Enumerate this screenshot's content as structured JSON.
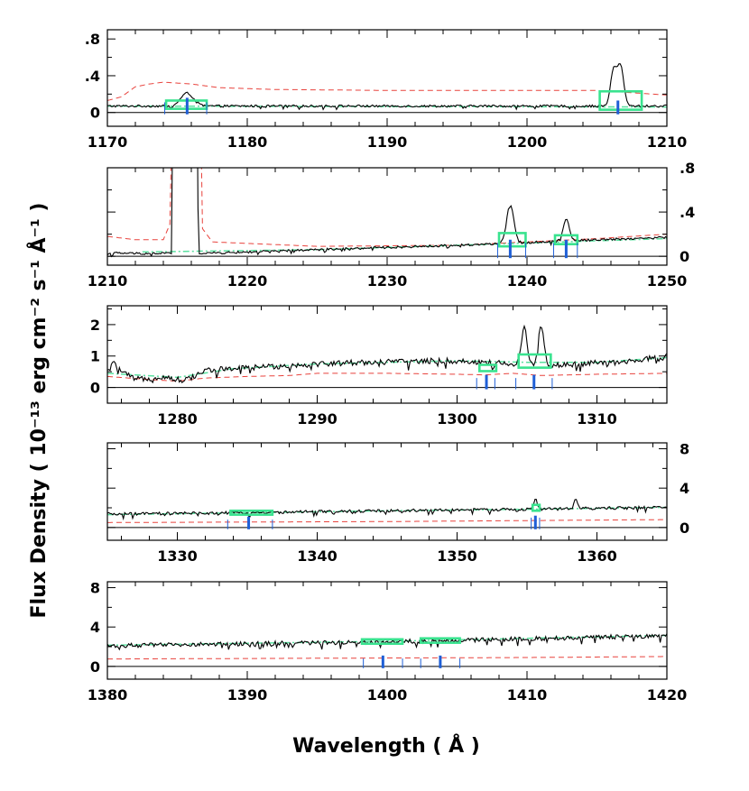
{
  "figure": {
    "ylabel": "Flux Density  ( 10⁻¹³ erg cm⁻² s⁻¹ Å⁻¹ )",
    "xlabel": "Wavelength  ( Å )",
    "colors": {
      "spectrum": "#000000",
      "error": "#e8423c",
      "continuum": "#5be0a0",
      "box": "#39e38f",
      "marker": "#1f5fd6",
      "axis": "#000000"
    }
  },
  "chart_data": [
    {
      "type": "line",
      "xlim": [
        1170,
        1210
      ],
      "ylim": [
        -0.15,
        0.9
      ],
      "xticks": [
        1170,
        1180,
        1190,
        1200,
        1210
      ],
      "xtick_labels": [
        "1170",
        "1180",
        "1190",
        "1200",
        "1210"
      ],
      "yticks": [
        0,
        0.4,
        0.8
      ],
      "ytick_labels": [
        "0",
        ".4",
        ".8"
      ],
      "yaxis_side": "left",
      "flux_baseline": 0.07,
      "flux_noise": 0.012,
      "error_points": [
        [
          1170,
          0.13
        ],
        [
          1171,
          0.17
        ],
        [
          1172,
          0.28
        ],
        [
          1173,
          0.31
        ],
        [
          1174,
          0.33
        ],
        [
          1176,
          0.31
        ],
        [
          1178,
          0.27
        ],
        [
          1182,
          0.25
        ],
        [
          1190,
          0.24
        ],
        [
          1200,
          0.24
        ],
        [
          1205,
          0.24
        ],
        [
          1208,
          0.21
        ],
        [
          1210,
          0.19
        ]
      ],
      "continuum_points": [
        [
          1170,
          0.07
        ],
        [
          1210,
          0.06
        ]
      ],
      "emission_lines": [
        {
          "center": 1175.7,
          "peak": 0.14,
          "width": 0.45
        },
        {
          "center": 1206.2,
          "peak": 0.4,
          "width": 0.22
        },
        {
          "center": 1206.7,
          "peak": 0.42,
          "width": 0.22
        }
      ],
      "boxes": [
        {
          "x0": 1174.2,
          "x1": 1177.1,
          "y0": 0.04,
          "y1": 0.13
        },
        {
          "x0": 1205.2,
          "x1": 1208.2,
          "y0": 0.03,
          "y1": 0.23
        }
      ],
      "markers": [
        {
          "x": 1174.1,
          "h": 0.11,
          "w": 1
        },
        {
          "x": 1175.7,
          "h": 0.16,
          "w": 3
        },
        {
          "x": 1177.1,
          "h": 0.11,
          "w": 1
        },
        {
          "x": 1206.5,
          "h": 0.13,
          "w": 3
        }
      ]
    },
    {
      "type": "line",
      "xlim": [
        1210,
        1250
      ],
      "ylim": [
        -0.08,
        0.8
      ],
      "xticks": [
        1210,
        1220,
        1230,
        1240,
        1250
      ],
      "xtick_labels": [
        "1210",
        "1220",
        "1230",
        "1240",
        "1250"
      ],
      "yticks": [
        0,
        0.4,
        0.8
      ],
      "ytick_labels": [
        "0",
        ".4",
        ".8"
      ],
      "yaxis_side": "right",
      "flux_noise": 0.01,
      "flux_points": [
        [
          1210,
          0.03
        ],
        [
          1213,
          0.025
        ],
        [
          1214.6,
          0.03
        ],
        [
          1214.9,
          5.0
        ],
        [
          1216.2,
          5.0
        ],
        [
          1216.5,
          0.03
        ],
        [
          1218,
          0.03
        ],
        [
          1225,
          0.06
        ],
        [
          1235,
          0.1
        ],
        [
          1245,
          0.15
        ],
        [
          1250,
          0.17
        ]
      ],
      "error_points": [
        [
          1210,
          0.18
        ],
        [
          1212,
          0.15
        ],
        [
          1214,
          0.15
        ],
        [
          1214.5,
          0.3
        ],
        [
          1214.9,
          5.0
        ],
        [
          1216.2,
          5.0
        ],
        [
          1216.8,
          0.25
        ],
        [
          1217.5,
          0.13
        ],
        [
          1225,
          0.09
        ],
        [
          1235,
          0.1
        ],
        [
          1245,
          0.16
        ],
        [
          1250,
          0.2
        ]
      ],
      "continuum_points": [
        [
          1212.5,
          0.04
        ],
        [
          1225,
          0.06
        ],
        [
          1235,
          0.1
        ],
        [
          1245,
          0.14
        ],
        [
          1250,
          0.16
        ]
      ],
      "emission_lines": [
        {
          "center": 1238.8,
          "peak": 0.35,
          "width": 0.25
        },
        {
          "center": 1242.8,
          "peak": 0.19,
          "width": 0.23
        }
      ],
      "boxes": [
        {
          "x0": 1238.0,
          "x1": 1239.9,
          "y0": 0.09,
          "y1": 0.21
        },
        {
          "x0": 1242.0,
          "x1": 1243.6,
          "y0": 0.11,
          "y1": 0.19
        }
      ],
      "markers": [
        {
          "x": 1237.9,
          "h": 0.12,
          "w": 1
        },
        {
          "x": 1238.8,
          "h": 0.15,
          "w": 3
        },
        {
          "x": 1239.9,
          "h": 0.12,
          "w": 1
        },
        {
          "x": 1241.9,
          "h": 0.12,
          "w": 1
        },
        {
          "x": 1242.8,
          "h": 0.15,
          "w": 3
        },
        {
          "x": 1243.6,
          "h": 0.12,
          "w": 1
        }
      ]
    },
    {
      "type": "line",
      "xlim": [
        1275,
        1315
      ],
      "ylim": [
        -0.5,
        2.6
      ],
      "xticks": [
        1280,
        1290,
        1300,
        1310
      ],
      "xtick_labels": [
        "1280",
        "1290",
        "1300",
        "1310"
      ],
      "yticks": [
        0,
        1,
        2
      ],
      "ytick_labels": [
        "0",
        "1",
        "2"
      ],
      "yaxis_side": "left",
      "flux_noise": 0.09,
      "flux_points": [
        [
          1275,
          0.5
        ],
        [
          1275.5,
          0.8
        ],
        [
          1276,
          0.5
        ],
        [
          1277,
          0.25
        ],
        [
          1278,
          0.3
        ],
        [
          1279,
          0.35
        ],
        [
          1280,
          0.25
        ],
        [
          1281,
          0.3
        ],
        [
          1282,
          0.55
        ],
        [
          1284,
          0.6
        ],
        [
          1286,
          0.65
        ],
        [
          1288,
          0.7
        ],
        [
          1290,
          0.75
        ],
        [
          1293,
          0.8
        ],
        [
          1296,
          0.82
        ],
        [
          1299,
          0.85
        ],
        [
          1302,
          0.8
        ],
        [
          1304,
          0.75
        ],
        [
          1306,
          0.7
        ],
        [
          1308,
          0.72
        ],
        [
          1310,
          0.78
        ],
        [
          1312,
          0.8
        ],
        [
          1315,
          1.0
        ]
      ],
      "error_points": [
        [
          1275,
          0.35
        ],
        [
          1278,
          0.25
        ],
        [
          1280,
          0.2
        ],
        [
          1282,
          0.3
        ],
        [
          1285,
          0.35
        ],
        [
          1288,
          0.38
        ],
        [
          1290,
          0.45
        ],
        [
          1295,
          0.45
        ],
        [
          1300,
          0.42
        ],
        [
          1302,
          0.4
        ],
        [
          1304,
          0.45
        ],
        [
          1306,
          0.38
        ],
        [
          1308,
          0.4
        ],
        [
          1310,
          0.42
        ],
        [
          1315,
          0.45
        ]
      ],
      "continuum_points": [
        [
          1275,
          0.45
        ],
        [
          1280,
          0.32
        ],
        [
          1284,
          0.6
        ],
        [
          1290,
          0.75
        ],
        [
          1300,
          0.85
        ],
        [
          1305,
          0.8
        ],
        [
          1310,
          0.8
        ],
        [
          1315,
          0.95
        ]
      ],
      "emission_lines": [
        {
          "center": 1304.8,
          "peak": 1.15,
          "width": 0.2
        },
        {
          "center": 1306.0,
          "peak": 1.3,
          "width": 0.2
        }
      ],
      "boxes": [
        {
          "x0": 1301.6,
          "x1": 1302.8,
          "y0": 0.52,
          "y1": 0.72
        },
        {
          "x0": 1304.4,
          "x1": 1306.7,
          "y0": 0.63,
          "y1": 1.05
        }
      ],
      "markers": [
        {
          "x": 1301.4,
          "h": 0.3,
          "w": 1
        },
        {
          "x": 1302.1,
          "h": 0.4,
          "w": 3
        },
        {
          "x": 1302.7,
          "h": 0.3,
          "w": 1
        },
        {
          "x": 1304.2,
          "h": 0.3,
          "w": 1
        },
        {
          "x": 1305.5,
          "h": 0.4,
          "w": 3
        },
        {
          "x": 1306.8,
          "h": 0.3,
          "w": 1
        }
      ]
    },
    {
      "type": "line",
      "xlim": [
        1325,
        1365
      ],
      "ylim": [
        -1.3,
        8.6
      ],
      "xticks": [
        1330,
        1340,
        1350,
        1360
      ],
      "xtick_labels": [
        "1330",
        "1340",
        "1350",
        "1360"
      ],
      "yticks": [
        0,
        4,
        8
      ],
      "ytick_labels": [
        "0",
        "4",
        "8"
      ],
      "yaxis_side": "right",
      "flux_noise": 0.15,
      "flux_points": [
        [
          1325,
          1.35
        ],
        [
          1335,
          1.5
        ],
        [
          1345,
          1.7
        ],
        [
          1355,
          1.85
        ],
        [
          1365,
          2.05
        ]
      ],
      "error_points": [
        [
          1325,
          0.5
        ],
        [
          1335,
          0.55
        ],
        [
          1345,
          0.6
        ],
        [
          1355,
          0.7
        ],
        [
          1365,
          0.8
        ]
      ],
      "continuum_points": [
        [
          1325,
          1.3
        ],
        [
          1335,
          1.5
        ],
        [
          1345,
          1.7
        ],
        [
          1355,
          1.85
        ],
        [
          1365,
          2.05
        ]
      ],
      "emission_lines": [
        {
          "center": 1355.6,
          "peak": 1.1,
          "width": 0.12
        },
        {
          "center": 1358.5,
          "peak": 1.0,
          "width": 0.12
        }
      ],
      "boxes": [
        {
          "x0": 1333.8,
          "x1": 1336.8,
          "y0": 1.3,
          "y1": 1.7
        },
        {
          "x0": 1355.4,
          "x1": 1355.9,
          "y0": 1.7,
          "y1": 2.3
        }
      ],
      "markers": [
        {
          "x": 1333.6,
          "h": 0.8,
          "w": 1
        },
        {
          "x": 1335.1,
          "h": 1.1,
          "w": 3
        },
        {
          "x": 1336.8,
          "h": 0.8,
          "w": 1
        },
        {
          "x": 1355.3,
          "h": 1.0,
          "w": 1
        },
        {
          "x": 1355.6,
          "h": 1.2,
          "w": 3
        },
        {
          "x": 1355.9,
          "h": 1.0,
          "w": 1
        }
      ]
    },
    {
      "type": "line",
      "xlim": [
        1380,
        1420
      ],
      "ylim": [
        -1.3,
        8.6
      ],
      "xticks": [
        1380,
        1390,
        1400,
        1410,
        1420
      ],
      "xtick_labels": [
        "1380",
        "1390",
        "1400",
        "1410",
        "1420"
      ],
      "yticks": [
        0,
        4,
        8
      ],
      "ytick_labels": [
        "0",
        "4",
        "8"
      ],
      "yaxis_side": "left",
      "flux_noise": 0.22,
      "flux_points": [
        [
          1380,
          2.1
        ],
        [
          1390,
          2.3
        ],
        [
          1400,
          2.5
        ],
        [
          1410,
          2.8
        ],
        [
          1420,
          3.1
        ]
      ],
      "error_points": [
        [
          1380,
          0.75
        ],
        [
          1390,
          0.8
        ],
        [
          1400,
          0.85
        ],
        [
          1410,
          0.9
        ],
        [
          1420,
          1.0
        ]
      ],
      "continuum_points": [
        [
          1380,
          2.15
        ],
        [
          1390,
          2.35
        ],
        [
          1400,
          2.55
        ],
        [
          1410,
          2.85
        ],
        [
          1420,
          3.15
        ]
      ],
      "emission_lines": [],
      "boxes": [
        {
          "x0": 1398.2,
          "x1": 1401.1,
          "y0": 2.3,
          "y1": 2.75
        },
        {
          "x0": 1402.4,
          "x1": 1405.2,
          "y0": 2.4,
          "y1": 2.85
        }
      ],
      "markers": [
        {
          "x": 1398.3,
          "h": 0.8,
          "w": 1
        },
        {
          "x": 1399.7,
          "h": 1.1,
          "w": 3
        },
        {
          "x": 1401.1,
          "h": 0.8,
          "w": 1
        },
        {
          "x": 1402.4,
          "h": 0.8,
          "w": 1
        },
        {
          "x": 1403.8,
          "h": 1.1,
          "w": 3
        },
        {
          "x": 1405.2,
          "h": 0.8,
          "w": 1
        }
      ]
    }
  ]
}
